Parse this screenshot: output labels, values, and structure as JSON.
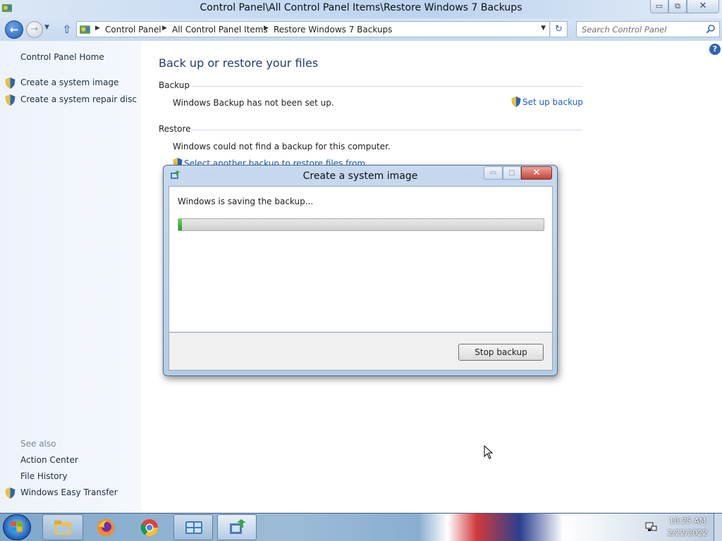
{
  "window": {
    "title": "Control Panel\\All Control Panel Items\\Restore Windows 7 Backups",
    "minimize_glyph": "▭",
    "maximize_glyph": "⧉",
    "close_glyph": "✕"
  },
  "address": {
    "back_glyph": "←",
    "forward_glyph": "→",
    "history_glyph": "▼",
    "up_glyph": "⇧",
    "crumbs": [
      "Control Panel",
      "All Control Panel Items",
      "Restore Windows 7 Backups"
    ],
    "separator": "▶",
    "dropdown_glyph": "▼",
    "refresh_glyph": "↻"
  },
  "search": {
    "placeholder": "Search Control Panel"
  },
  "left_pane": {
    "home": "Control Panel Home",
    "tasks": [
      "Create a system image",
      "Create a system repair disc"
    ],
    "see_also_label": "See also",
    "see_also": [
      "Action Center",
      "File History",
      "Windows Easy Transfer"
    ]
  },
  "main": {
    "help_glyph": "?",
    "title": "Back up or restore your files",
    "backup_heading": "Backup",
    "backup_status": "Windows Backup has not been set up.",
    "setup_link": "Set up backup",
    "restore_heading": "Restore",
    "restore_status": "Windows could not find a backup for this computer.",
    "select_link": "Select another backup to restore files from"
  },
  "dialog": {
    "title": "Create a system image",
    "minimize_glyph": "▭",
    "maximize_glyph": "▢",
    "close_glyph": "✕",
    "status": "Windows is saving the backup...",
    "progress_percent": 1,
    "stop_label": "Stop backup"
  },
  "taskbar": {
    "apps": [
      "start-orb",
      "file-explorer",
      "firefox",
      "chrome",
      "control-panel",
      "backup-restore"
    ],
    "time": "10:25 AM",
    "date": "2/22/2022"
  },
  "colors": {
    "link": "#1f5fb8",
    "page_title": "#1e3d6f",
    "progress": "#1f9e2a",
    "dialog_close": "#c2453a"
  }
}
